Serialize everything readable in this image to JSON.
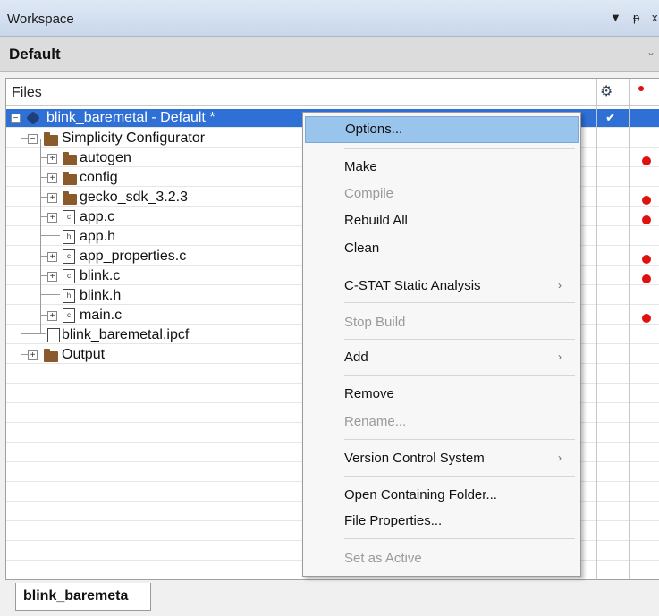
{
  "window": {
    "title": "Workspace",
    "controls": [
      "▼",
      "ᵽ",
      "x"
    ]
  },
  "config": {
    "value": "Default"
  },
  "panel": {
    "header": {
      "files_label": "Files"
    },
    "tree": [
      {
        "label": "blink_baremetal - Default *"
      },
      {
        "label": "Simplicity Configurator"
      },
      {
        "label": "autogen"
      },
      {
        "label": "config"
      },
      {
        "label": "gecko_sdk_3.2.3"
      },
      {
        "label": "app.c",
        "badge": "c"
      },
      {
        "label": "app.h",
        "badge": "h"
      },
      {
        "label": "app_properties.c",
        "badge": "c"
      },
      {
        "label": "blink.c",
        "badge": "c"
      },
      {
        "label": "blink.h",
        "badge": "h"
      },
      {
        "label": "main.c",
        "badge": "c"
      },
      {
        "label": "blink_baremetal.ipcf"
      },
      {
        "label": "Output"
      }
    ]
  },
  "context_menu": {
    "items": [
      {
        "label": "Options..."
      },
      {
        "label": "Make"
      },
      {
        "label": "Compile"
      },
      {
        "label": "Rebuild All"
      },
      {
        "label": "Clean"
      },
      {
        "label": "C-STAT Static Analysis"
      },
      {
        "label": "Stop Build"
      },
      {
        "label": "Add"
      },
      {
        "label": "Remove"
      },
      {
        "label": "Rename..."
      },
      {
        "label": "Version Control System"
      },
      {
        "label": "Open Containing Folder..."
      },
      {
        "label": "File Properties..."
      },
      {
        "label": "Set as Active"
      }
    ]
  },
  "bottom_tab": {
    "label": "blink_baremeta"
  },
  "colors": {
    "selection": "#2f70d6",
    "menu_highlight": "#99c4ec",
    "status_dot": "#e01010",
    "folder": "#8b5a2b"
  }
}
